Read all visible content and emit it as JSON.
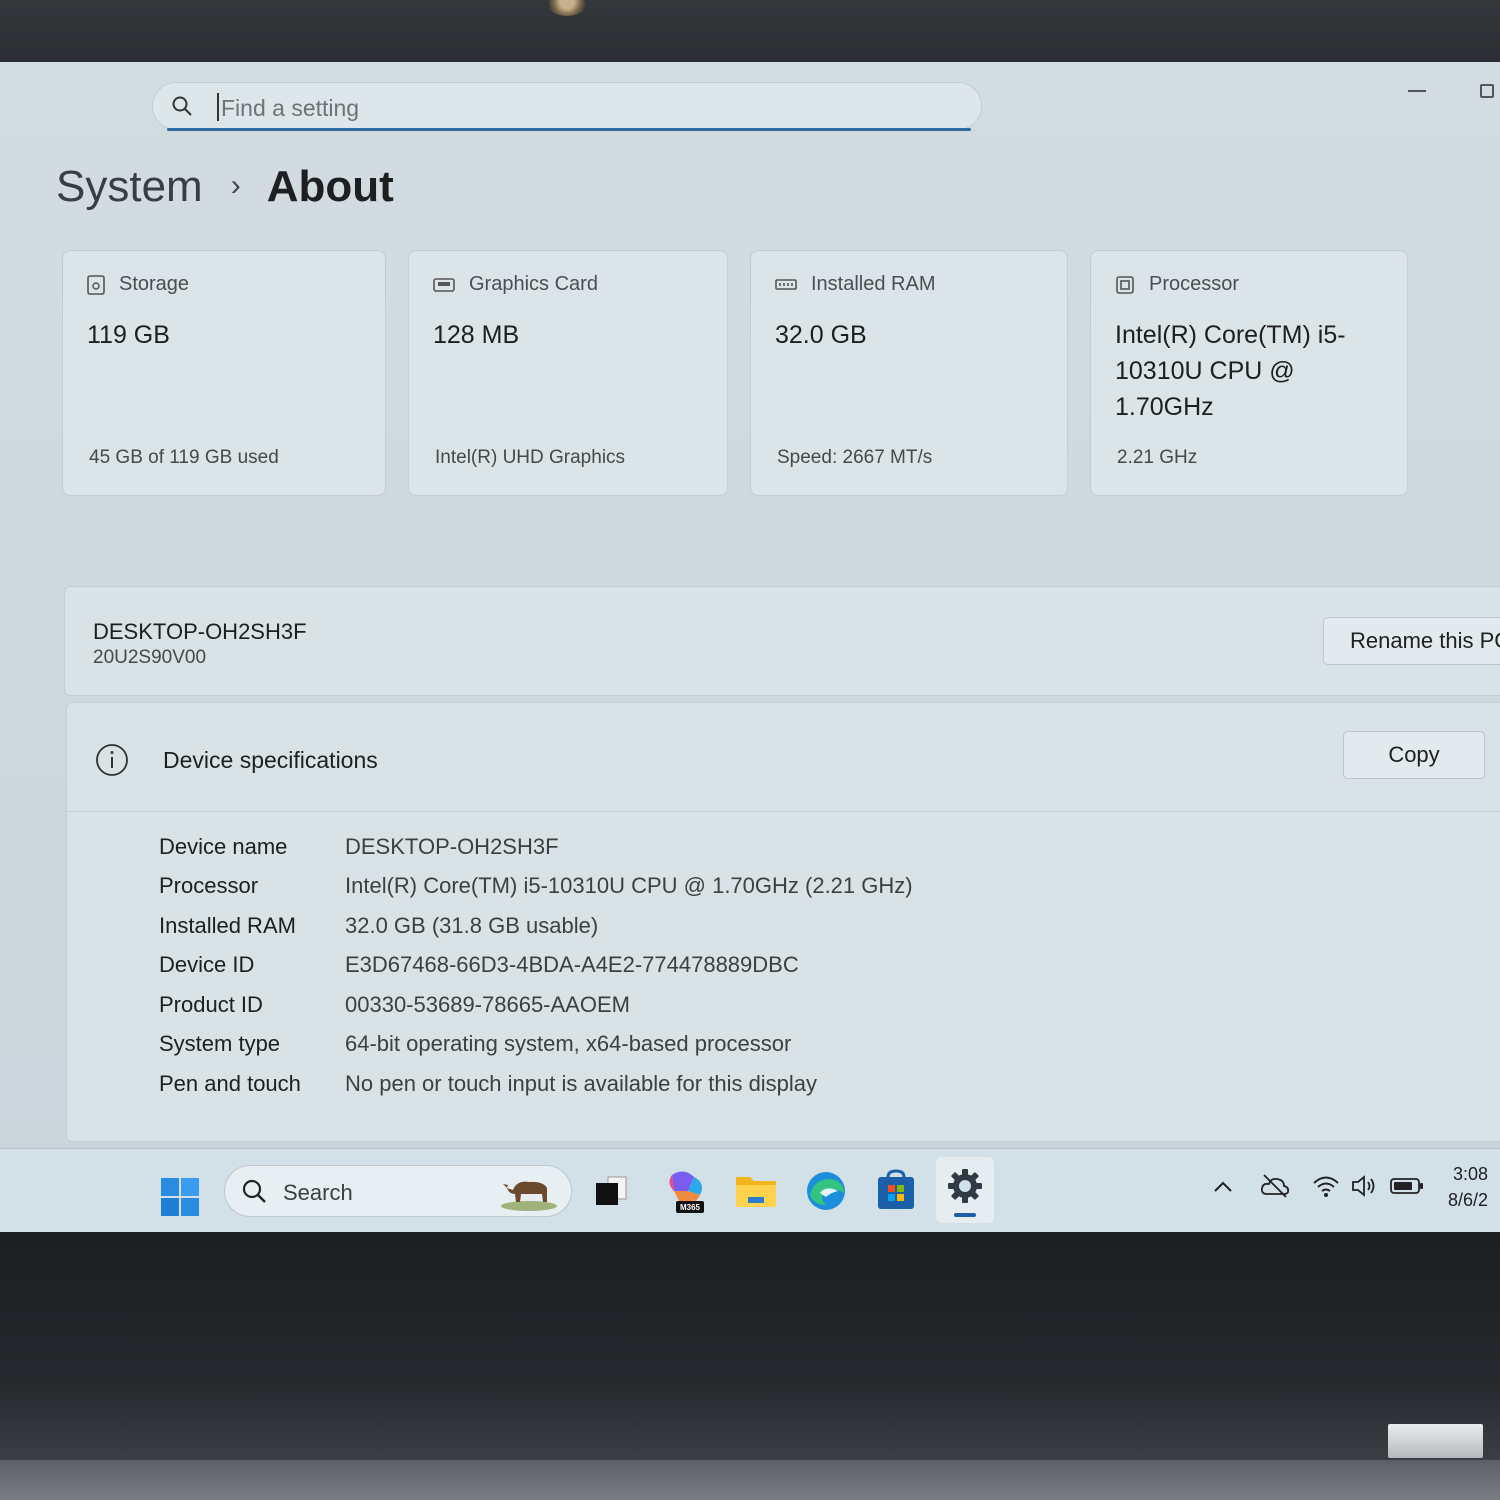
{
  "search": {
    "placeholder": "Find a setting"
  },
  "breadcrumb": {
    "parent": "System",
    "separator": "›",
    "current": "About"
  },
  "cards": [
    {
      "title": "Storage",
      "value": "119 GB",
      "sub": "45 GB of 119 GB used",
      "icon": "storage-icon"
    },
    {
      "title": "Graphics Card",
      "value": "128 MB",
      "sub": "Intel(R) UHD Graphics",
      "icon": "graphics-card-icon"
    },
    {
      "title": "Installed RAM",
      "value": "32.0 GB",
      "sub": "Speed: 2667 MT/s",
      "icon": "ram-icon"
    },
    {
      "title": "Processor",
      "value": "Intel(R) Core(TM) i5-10310U CPU @ 1.70GHz",
      "sub": "2.21 GHz",
      "icon": "processor-icon"
    }
  ],
  "pc": {
    "name": "DESKTOP-OH2SH3F",
    "model": "20U2S90V00",
    "rename_label": "Rename this PC"
  },
  "specs": {
    "title": "Device specifications",
    "copy_label": "Copy",
    "rows": [
      {
        "label": "Device name",
        "value": "DESKTOP-OH2SH3F"
      },
      {
        "label": "Processor",
        "value": "Intel(R) Core(TM) i5-10310U CPU @ 1.70GHz (2.21 GHz)"
      },
      {
        "label": "Installed RAM",
        "value": "32.0 GB (31.8 GB usable)"
      },
      {
        "label": "Device ID",
        "value": "E3D67468-66D3-4BDA-A4E2-774478889DBC"
      },
      {
        "label": "Product ID",
        "value": "00330-53689-78665-AAOEM"
      },
      {
        "label": "System type",
        "value": "64-bit operating system, x64-based processor"
      },
      {
        "label": "Pen and touch",
        "value": "No pen or touch input is available for this display"
      }
    ]
  },
  "taskbar": {
    "search_label": "Search",
    "m365_badge": "M365",
    "apps": [
      "windows-start-icon",
      "task-view-icon",
      "microsoft-365-copilot-icon",
      "file-explorer-icon",
      "edge-icon",
      "microsoft-store-icon",
      "settings-icon"
    ],
    "time": "3:08",
    "date": "8/6/2"
  },
  "colors": {
    "accent": "#1f5fa8",
    "background": "#cfdade",
    "card": "#dbe4e7"
  }
}
